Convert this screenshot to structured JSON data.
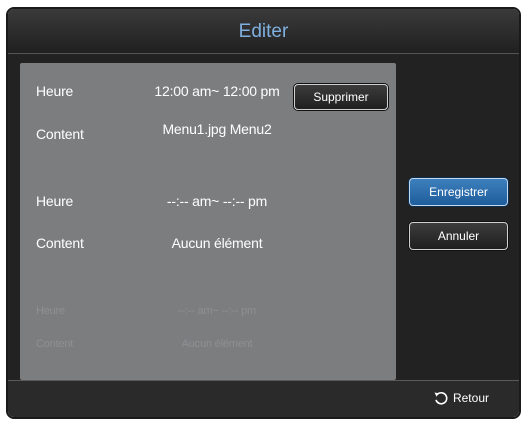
{
  "dialog": {
    "title": "Editer"
  },
  "schedule": {
    "entries": [
      {
        "heure_label": "Heure",
        "heure_value": "12:00 am~ 12:00 pm",
        "content_label": "Content",
        "content_value": "Menu1.jpg Menu2"
      },
      {
        "heure_label": "Heure",
        "heure_value": "--:-- am~ --:-- pm",
        "content_label": "Content",
        "content_value": "Aucun élément"
      },
      {
        "heure_label": "Heure",
        "heure_value": "--:-- am~ --:-- pm",
        "content_label": "Content",
        "content_value": "Aucun élément"
      }
    ],
    "delete_label": "Supprimer"
  },
  "actions": {
    "save_label": "Enregistrer",
    "cancel_label": "Annuler"
  },
  "footer": {
    "back_label": "Retour",
    "back_icon": "return-arrow-icon"
  },
  "colors": {
    "title": "#7fb0e0",
    "panel": "#7b7d7f",
    "save_button": "#2a6aa8",
    "background": "#222222"
  }
}
